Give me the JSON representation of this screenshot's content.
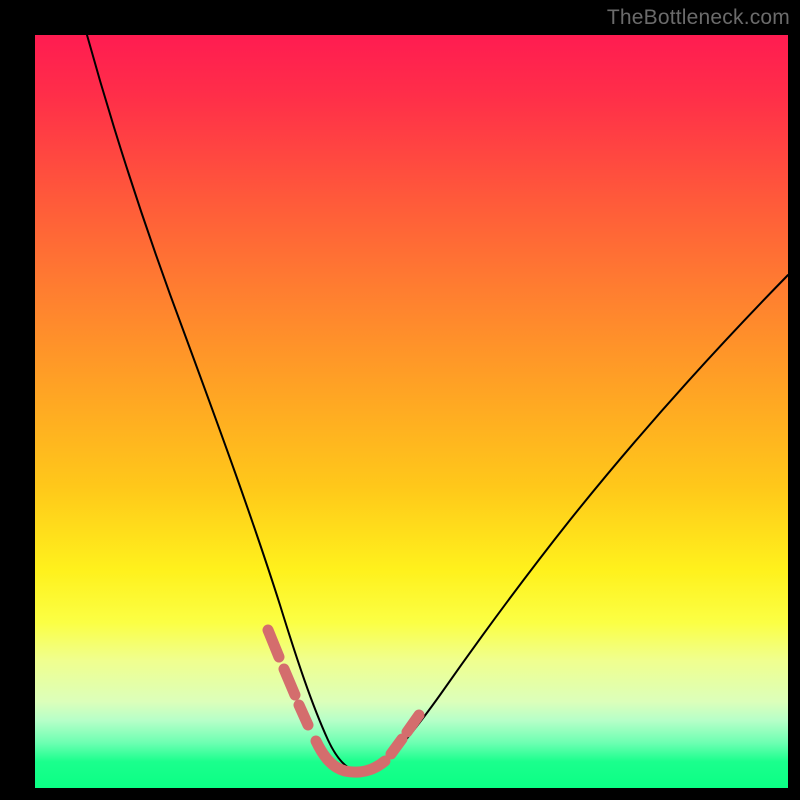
{
  "watermark": "TheBottleneck.com",
  "colors": {
    "page_bg": "#000000",
    "highlight_stroke": "#d46d6d",
    "curve_stroke": "#000000",
    "gradient_stops": [
      "#ff1c51",
      "#ff2e49",
      "#ff5a3a",
      "#ff7e30",
      "#ffa324",
      "#ffc81a",
      "#fff11c",
      "#fbff44",
      "#f0ff8e",
      "#dcffba",
      "#b7ffc8",
      "#6dffb2",
      "#1bff8d",
      "#0aff84"
    ]
  },
  "chart_data": {
    "type": "line",
    "title": "",
    "xlabel": "",
    "ylabel": "",
    "xlim": [
      0,
      100
    ],
    "ylim": [
      0,
      100
    ],
    "grid": false,
    "series": [
      {
        "name": "bottleneck-curve",
        "x": [
          7,
          10,
          14,
          18,
          22,
          26,
          29,
          31,
          33,
          35,
          36.5,
          38,
          39.5,
          41,
          43,
          45.5,
          48,
          51,
          55,
          60,
          66,
          73,
          81,
          90,
          100
        ],
        "y": [
          100,
          89,
          76,
          63,
          50,
          37,
          27,
          20,
          14,
          9,
          6,
          4,
          3,
          3,
          3,
          4,
          6,
          9,
          13,
          19,
          26,
          34,
          43,
          52,
          62
        ]
      }
    ],
    "highlight_segments": [
      {
        "name": "left-dots",
        "x": [
          29.5,
          33.5
        ],
        "y": [
          25,
          12
        ]
      },
      {
        "name": "flat-bottom",
        "x": [
          35,
          44
        ],
        "y": [
          6.5,
          3,
          3,
          3,
          5
        ]
      },
      {
        "name": "right-dots",
        "x": [
          46,
          50
        ],
        "y": [
          7,
          11
        ]
      }
    ]
  }
}
